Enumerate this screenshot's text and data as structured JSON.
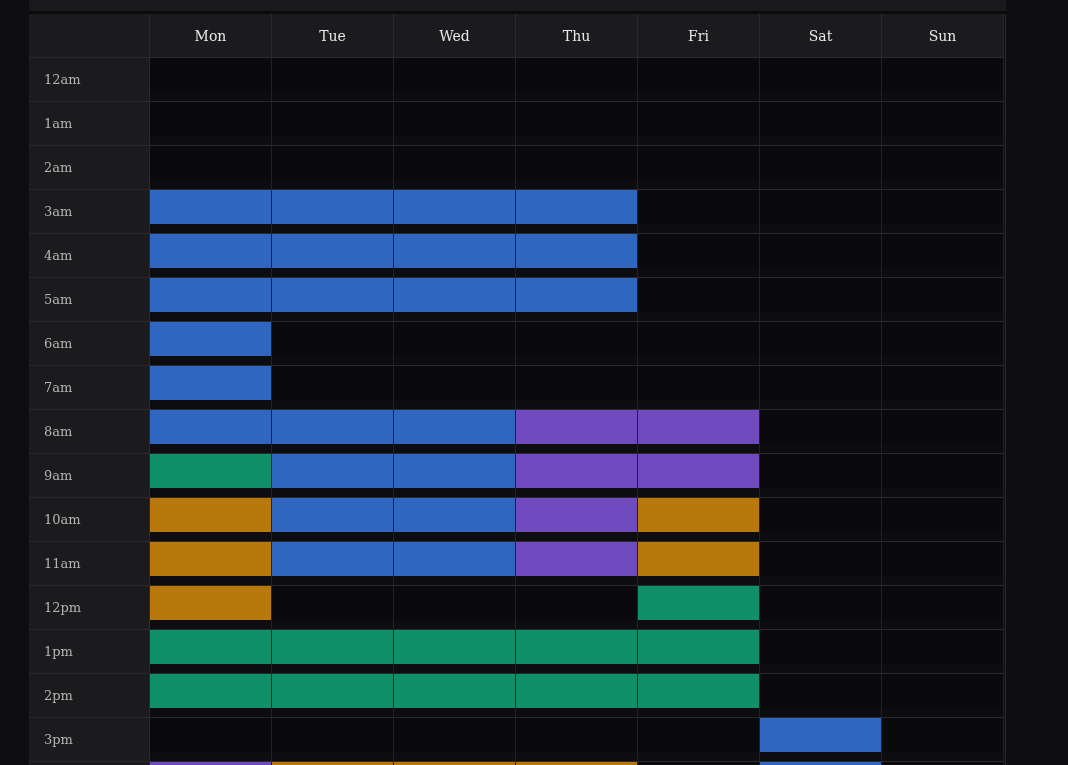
{
  "days": [
    "Mon",
    "Tue",
    "Wed",
    "Thu",
    "Fri",
    "Sat",
    "Sun"
  ],
  "rows": [
    {
      "label": "12am",
      "cells": [
        {
          "kind": "free"
        },
        {
          "kind": "free"
        },
        {
          "kind": "free"
        },
        {
          "kind": "free"
        },
        {
          "kind": "free"
        },
        {
          "kind": "free"
        },
        {
          "kind": "free"
        }
      ]
    },
    {
      "label": "1am",
      "cells": [
        {
          "kind": "free"
        },
        {
          "kind": "free"
        },
        {
          "kind": "free"
        },
        {
          "kind": "free"
        },
        {
          "kind": "free"
        },
        {
          "kind": "free"
        },
        {
          "kind": "free"
        }
      ]
    },
    {
      "label": "2am",
      "cells": [
        {
          "kind": "free"
        },
        {
          "kind": "free"
        },
        {
          "kind": "free"
        },
        {
          "kind": "free"
        },
        {
          "kind": "free"
        },
        {
          "kind": "free"
        },
        {
          "kind": "free"
        }
      ]
    },
    {
      "label": "3am",
      "cells": [
        {
          "kind": "event",
          "color": "#2f66c0"
        },
        {
          "kind": "event",
          "color": "#2f66c0"
        },
        {
          "kind": "event",
          "color": "#2f66c0"
        },
        {
          "kind": "event",
          "color": "#2f66c0"
        },
        {
          "kind": "free"
        },
        {
          "kind": "free"
        },
        {
          "kind": "free"
        }
      ]
    },
    {
      "label": "4am",
      "cells": [
        {
          "kind": "event",
          "color": "#2f66c0"
        },
        {
          "kind": "event",
          "color": "#2f66c0"
        },
        {
          "kind": "event",
          "color": "#2f66c0"
        },
        {
          "kind": "event",
          "color": "#2f66c0"
        },
        {
          "kind": "free"
        },
        {
          "kind": "free"
        },
        {
          "kind": "free"
        }
      ]
    },
    {
      "label": "5am",
      "cells": [
        {
          "kind": "event",
          "color": "#2f66c0"
        },
        {
          "kind": "event",
          "color": "#2f66c0"
        },
        {
          "kind": "event",
          "color": "#2f66c0"
        },
        {
          "kind": "event",
          "color": "#2f66c0"
        },
        {
          "kind": "free"
        },
        {
          "kind": "free"
        },
        {
          "kind": "free"
        }
      ]
    },
    {
      "label": "6am",
      "cells": [
        {
          "kind": "event",
          "color": "#2f66c0"
        },
        {
          "kind": "free"
        },
        {
          "kind": "free"
        },
        {
          "kind": "free"
        },
        {
          "kind": "free"
        },
        {
          "kind": "free"
        },
        {
          "kind": "free"
        }
      ]
    },
    {
      "label": "7am",
      "cells": [
        {
          "kind": "event",
          "color": "#2f66c0"
        },
        {
          "kind": "free"
        },
        {
          "kind": "free"
        },
        {
          "kind": "free"
        },
        {
          "kind": "free"
        },
        {
          "kind": "free"
        },
        {
          "kind": "free"
        }
      ]
    },
    {
      "label": "8am",
      "cells": [
        {
          "kind": "event",
          "color": "#2f66c0"
        },
        {
          "kind": "event",
          "color": "#2f66c0"
        },
        {
          "kind": "event",
          "color": "#2f66c0"
        },
        {
          "kind": "event",
          "color": "#6f4bbf"
        },
        {
          "kind": "event",
          "color": "#6f4bbf"
        },
        {
          "kind": "free"
        },
        {
          "kind": "free"
        }
      ]
    },
    {
      "label": "9am",
      "cells": [
        {
          "kind": "event",
          "color": "#0f9068"
        },
        {
          "kind": "event",
          "color": "#2f66c0"
        },
        {
          "kind": "event",
          "color": "#2f66c0"
        },
        {
          "kind": "event",
          "color": "#6f4bbf"
        },
        {
          "kind": "event",
          "color": "#6f4bbf"
        },
        {
          "kind": "free"
        },
        {
          "kind": "free"
        }
      ]
    },
    {
      "label": "10am",
      "cells": [
        {
          "kind": "event",
          "color": "#b8780c"
        },
        {
          "kind": "event",
          "color": "#2f66c0"
        },
        {
          "kind": "event",
          "color": "#2f66c0"
        },
        {
          "kind": "event",
          "color": "#6f4bbf"
        },
        {
          "kind": "event",
          "color": "#b8780c"
        },
        {
          "kind": "free"
        },
        {
          "kind": "free"
        }
      ]
    },
    {
      "label": "11am",
      "cells": [
        {
          "kind": "event",
          "color": "#b8780c"
        },
        {
          "kind": "event",
          "color": "#2f66c0"
        },
        {
          "kind": "event",
          "color": "#2f66c0"
        },
        {
          "kind": "event",
          "color": "#6f4bbf"
        },
        {
          "kind": "event",
          "color": "#b8780c"
        },
        {
          "kind": "free"
        },
        {
          "kind": "free"
        }
      ]
    },
    {
      "label": "12pm",
      "cells": [
        {
          "kind": "event",
          "color": "#b8780c"
        },
        {
          "kind": "free"
        },
        {
          "kind": "free"
        },
        {
          "kind": "free"
        },
        {
          "kind": "event",
          "color": "#0f9068"
        },
        {
          "kind": "free"
        },
        {
          "kind": "free"
        }
      ]
    },
    {
      "label": "1pm",
      "cells": [
        {
          "kind": "event",
          "color": "#0f9068"
        },
        {
          "kind": "event",
          "color": "#0f9068"
        },
        {
          "kind": "event",
          "color": "#0f9068"
        },
        {
          "kind": "event",
          "color": "#0f9068"
        },
        {
          "kind": "event",
          "color": "#0f9068"
        },
        {
          "kind": "free"
        },
        {
          "kind": "free"
        }
      ]
    },
    {
      "label": "2pm",
      "cells": [
        {
          "kind": "event",
          "color": "#0f9068"
        },
        {
          "kind": "event",
          "color": "#0f9068"
        },
        {
          "kind": "event",
          "color": "#0f9068"
        },
        {
          "kind": "event",
          "color": "#0f9068"
        },
        {
          "kind": "event",
          "color": "#0f9068"
        },
        {
          "kind": "free"
        },
        {
          "kind": "free"
        }
      ]
    },
    {
      "label": "3pm",
      "cells": [
        {
          "kind": "free"
        },
        {
          "kind": "free"
        },
        {
          "kind": "free"
        },
        {
          "kind": "free"
        },
        {
          "kind": "free"
        },
        {
          "kind": "event",
          "color": "#2f66c0"
        },
        {
          "kind": "free"
        }
      ]
    },
    {
      "cells": [
        {
          "kind": "event",
          "color": "#6f4bbf"
        },
        {
          "kind": "event",
          "color": "#b8780c"
        },
        {
          "kind": "event",
          "color": "#b8780c"
        },
        {
          "kind": "event",
          "color": "#b8780c"
        },
        {
          "kind": "free"
        },
        {
          "kind": "event",
          "color": "#2f66c0"
        },
        {
          "kind": "free"
        }
      ]
    }
  ]
}
